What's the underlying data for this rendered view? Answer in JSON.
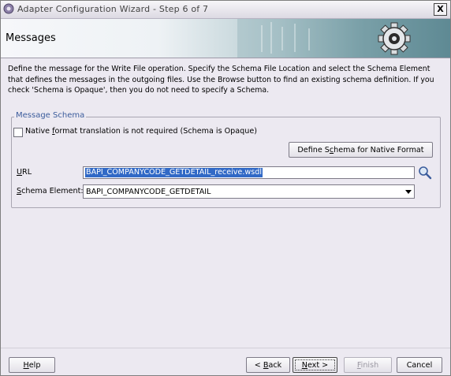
{
  "window": {
    "title": "Adapter Configuration Wizard - Step 6 of 7",
    "close_label": "X"
  },
  "header": {
    "title": "Messages"
  },
  "description": "Define the message for the Write File operation.  Specify the Schema File Location and select the Schema Element that defines the messages in the outgoing files. Use the Browse button to find an existing schema definition. If you check 'Schema is Opaque', then you do not need to specify a Schema.",
  "group": {
    "legend": "Message Schema",
    "native_checkbox": {
      "label_pre": "Native ",
      "label_mnemonic": "f",
      "label_post": "ormat translation is not required (Schema is Opaque)",
      "checked": false
    },
    "define_button": {
      "pre": "Define S",
      "mnemonic": "c",
      "post": "hema for Native Format"
    },
    "url_label": {
      "mnemonic": "U",
      "post": "RL"
    },
    "url_value": "BAPI_COMPANYCODE_GETDETAIL_receive.wsdl",
    "element_label": {
      "mnemonic": "S",
      "post": "chema Element:"
    },
    "element_value": "BAPI_COMPANYCODE_GETDETAIL"
  },
  "footer": {
    "help": {
      "mnemonic": "H",
      "post": "elp"
    },
    "back": {
      "pre": "< ",
      "mnemonic": "B",
      "post": "ack"
    },
    "next": {
      "mnemonic": "N",
      "post": "ext >"
    },
    "finish": {
      "mnemonic": "F",
      "post": "inish"
    },
    "cancel": "Cancel"
  },
  "colors": {
    "accent": "#3b5c9c",
    "selection": "#3169c6",
    "background": "#ece9f1"
  },
  "icons": [
    "app-icon",
    "close-icon",
    "gear-icon",
    "search-icon",
    "chevron-down-icon"
  ]
}
